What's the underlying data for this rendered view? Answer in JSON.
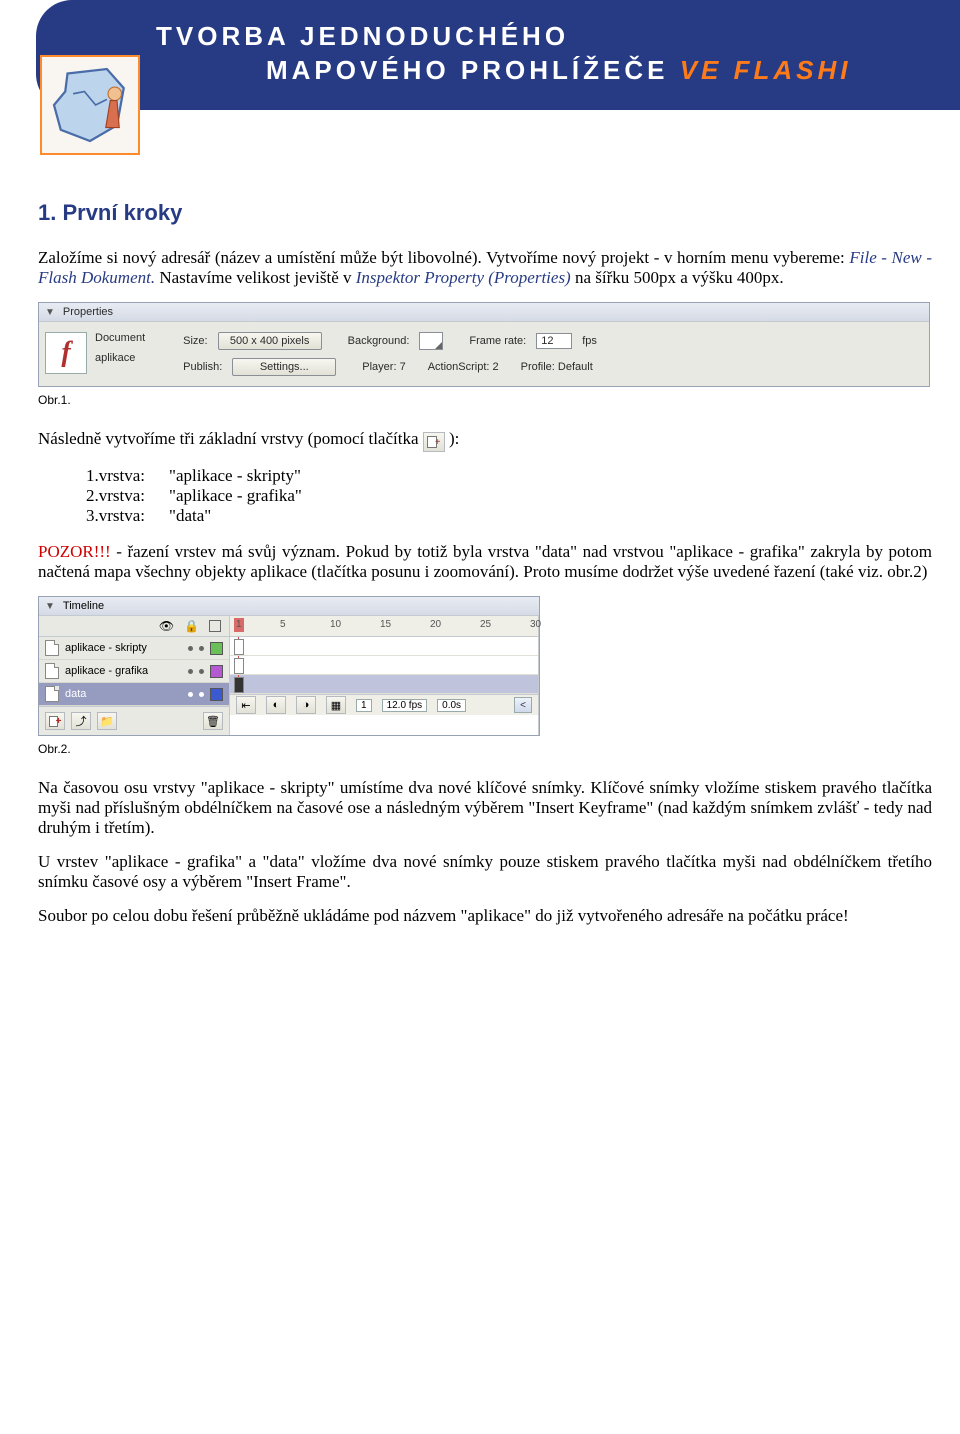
{
  "banner": {
    "line1": "Tvorba jednoduchého",
    "line2a": "mapového prohlížeče ",
    "line2b": "ve FLASHI"
  },
  "section1": {
    "heading": "1. První kroky",
    "p1a": "Založíme si nový adresář (název a umístění může být libovolné). Vytvoříme nový projekt - v horním menu vybereme: ",
    "p1b": "File - New - Flash Dokument. ",
    "p1c": "Nastavíme velikost jeviště v ",
    "p1d": "Inspektor Property (Properties)",
    "p1e": " na šířku 500px a výšku 400px.",
    "fig1_caption": "Obr.1.",
    "p2": "Následně vytvoříme tři základní vrstvy (pomocí tlačítka ",
    "p2b": "):",
    "layers": [
      {
        "k": "1.vrstva:",
        "v": "\"aplikace - skripty\""
      },
      {
        "k": "2.vrstva:",
        "v": "\"aplikace - grafika\""
      },
      {
        "k": "3.vrstva:",
        "v": "\"data\""
      }
    ],
    "warn_label": "POZOR!!!",
    "p3": " - řazení vrstev má svůj význam. Pokud by totiž byla vrstva \"data\" nad vrstvou \"aplikace - grafika\" zakryla by potom načtená mapa všechny objekty aplikace (tlačítka posunu i zoomování). Proto musíme dodržet výše uvedené řazení (také viz. obr.2)",
    "fig2_caption": "Obr.2.",
    "p4": "Na časovou osu vrstvy \"aplikace - skripty\" umístíme dva nové klíčové snímky. Klíčové snímky vložíme stiskem pravého tlačítka myši nad příslušným obdélníčkem na časové ose a následným výběrem \"Insert Keyframe\" (nad každým snímkem zvlášť - tedy nad druhým i třetím).",
    "p5": "U vrstev \"aplikace - grafika\" a \"data\" vložíme dva nové snímky pouze stiskem pravého tlačítka myši nad obdélníčkem třetího snímku časové osy a výběrem \"Insert Frame\".",
    "p6": "Soubor po celou dobu řešení průběžně ukládáme pod názvem \"aplikace\" do již vytvořeného adresáře na počátku práce!"
  },
  "obr1": {
    "panel_title": "Properties",
    "doc_label": "Document",
    "app_label": "aplikace",
    "size_label": "Size:",
    "size_value": "500 x 400 pixels",
    "bg_label": "Background:",
    "framerate_label": "Frame rate:",
    "framerate_value": "12",
    "fps_label": "fps",
    "publish_label": "Publish:",
    "settings_label": "Settings...",
    "player_label": "Player: 7",
    "as_label": "ActionScript: 2",
    "profile_label": "Profile: Default"
  },
  "obr2": {
    "panel_title": "Timeline",
    "ruler": [
      "1",
      "5",
      "10",
      "15",
      "20",
      "25",
      "30"
    ],
    "layers": [
      {
        "name": "aplikace - skripty",
        "swatch": "#6bbf59"
      },
      {
        "name": "aplikace - grafika",
        "swatch": "#b459d1"
      },
      {
        "name": "data",
        "swatch": "#3b59d1"
      }
    ],
    "footer": {
      "frame": "1",
      "fps": "12.0 fps",
      "time": "0.0s"
    }
  }
}
